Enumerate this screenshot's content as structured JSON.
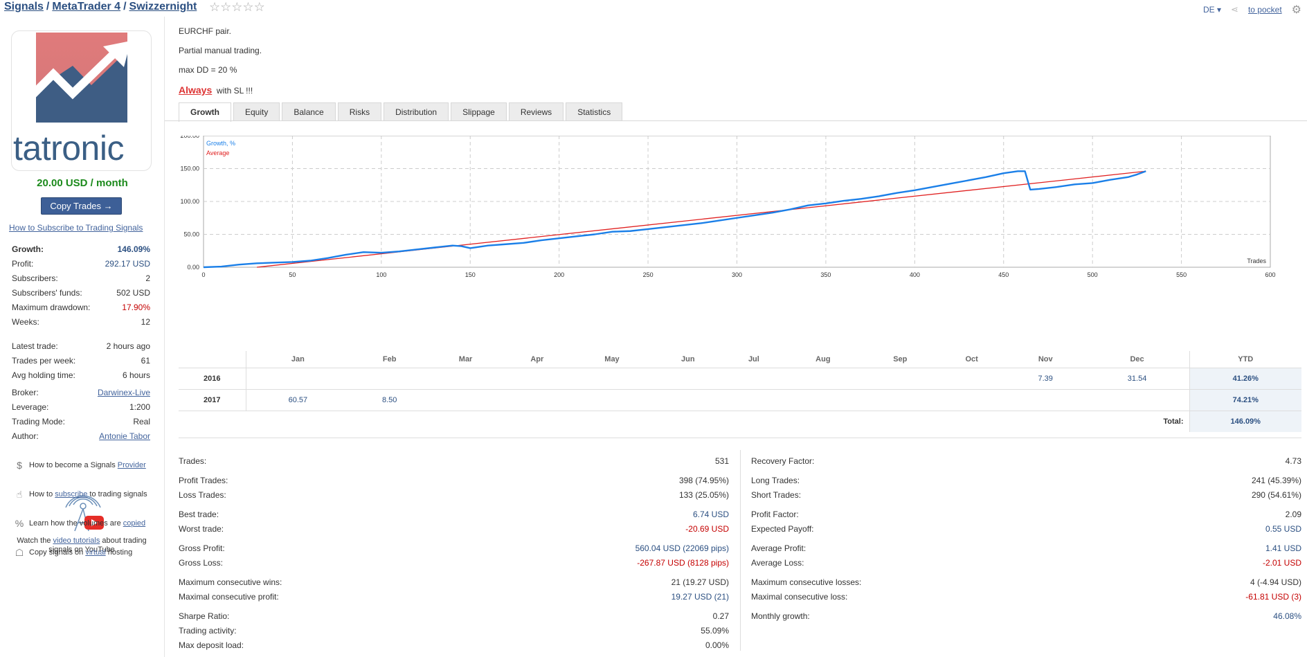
{
  "header": {
    "breadcrumb": [
      "Signals",
      "MetaTrader 4",
      "Swizzernight"
    ],
    "separator": "/",
    "language": "DE",
    "to_pocket": "to pocket"
  },
  "sidebar": {
    "logo_text": "tatronic",
    "price": "20.00 USD / month",
    "copy_button": "Copy Trades →",
    "howto_link": "How to Subscribe to Trading Signals",
    "group1": [
      {
        "k": "Growth:",
        "v": "146.09%"
      },
      {
        "k": "Profit:",
        "v": "292.17 USD"
      },
      {
        "k": "Subscribers:",
        "v": "2"
      },
      {
        "k": "Subscribers' funds:",
        "v": "502 USD"
      },
      {
        "k": "Maximum drawdown:",
        "v": "17.90%"
      },
      {
        "k": "Weeks:",
        "v": "12"
      }
    ],
    "group2": [
      {
        "k": "Latest trade:",
        "v": "2 hours ago"
      },
      {
        "k": "Trades per week:",
        "v": "61"
      },
      {
        "k": "Avg holding time:",
        "v": "6 hours"
      }
    ],
    "group3": [
      {
        "k": "Broker:",
        "v": "Darwinex-Live"
      },
      {
        "k": "Leverage:",
        "v": "1:200"
      },
      {
        "k": "Trading Mode:",
        "v": "Real"
      },
      {
        "k": "Author:",
        "v": "Antonie Tabor"
      }
    ],
    "yt_text_1": "Watch the ",
    "yt_link": "video tutorials",
    "yt_text_2": " about trading signals on YouTube",
    "help": [
      {
        "pre": "How to become a Signals ",
        "link": "Provider",
        "post": ""
      },
      {
        "pre": "How to ",
        "link": "subscribe",
        "post": " to trading signals"
      },
      {
        "pre": "Learn how the volumes are ",
        "link": "copied",
        "post": ""
      },
      {
        "pre": "Copy signals on ",
        "link": "virtual",
        "post": " hosting"
      }
    ]
  },
  "description": {
    "line1": "EURCHF pair.",
    "line2": "Partial manual trading.",
    "line3": "max DD = 20 %",
    "always": "Always",
    "with_sl": "with SL !!!"
  },
  "tabs": [
    "Growth",
    "Equity",
    "Balance",
    "Risks",
    "Distribution",
    "Slippage",
    "Reviews",
    "Statistics"
  ],
  "chart_data": {
    "type": "line",
    "legend": [
      "Growth, %",
      "Average"
    ],
    "xlabel": "Trades",
    "xlim": [
      0,
      600
    ],
    "ylim": [
      0,
      200
    ],
    "x_ticks": [
      0,
      50,
      100,
      150,
      200,
      250,
      300,
      350,
      400,
      450,
      500,
      550,
      600
    ],
    "y_ticks": [
      "0.00",
      "50.00",
      "100.00",
      "150.00",
      "200.00"
    ],
    "colors": {
      "growth": "#1a7fe8",
      "average": "#e02020"
    },
    "series": [
      {
        "name": "Growth, %",
        "x": [
          0,
          10,
          20,
          30,
          40,
          50,
          60,
          70,
          80,
          90,
          100,
          110,
          120,
          130,
          140,
          145,
          150,
          160,
          170,
          180,
          190,
          200,
          210,
          220,
          230,
          240,
          250,
          260,
          270,
          280,
          290,
          300,
          310,
          320,
          330,
          340,
          350,
          360,
          370,
          380,
          390,
          400,
          410,
          420,
          430,
          440,
          450,
          458,
          462,
          465,
          470,
          480,
          490,
          500,
          510,
          520,
          525,
          530
        ],
        "values": [
          0,
          1,
          4,
          6,
          7,
          8,
          10,
          14,
          19,
          23,
          22,
          24,
          27,
          30,
          33,
          32,
          29,
          33,
          35,
          37,
          41,
          44,
          47,
          50,
          54,
          55,
          58,
          61,
          64,
          67,
          71,
          75,
          79,
          83,
          88,
          94,
          97,
          101,
          104,
          108,
          113,
          117,
          122,
          127,
          132,
          137,
          143,
          146,
          146,
          118,
          119,
          122,
          126,
          128,
          133,
          137,
          141,
          146
        ]
      },
      {
        "name": "Average",
        "x": [
          30,
          530
        ],
        "values": [
          0,
          146
        ]
      }
    ]
  },
  "monthly": {
    "months": [
      "Jan",
      "Feb",
      "Mar",
      "Apr",
      "May",
      "Jun",
      "Jul",
      "Aug",
      "Sep",
      "Oct",
      "Nov",
      "Dec"
    ],
    "ytd_label": "YTD",
    "rows": [
      {
        "year": "2016",
        "values": [
          "",
          "",
          "",
          "",
          "",
          "",
          "",
          "",
          "",
          "",
          "7.39",
          "31.54"
        ],
        "ytd": "41.26%"
      },
      {
        "year": "2017",
        "values": [
          "60.57",
          "8.50",
          "",
          "",
          "",
          "",
          "",
          "",
          "",
          "",
          "",
          ""
        ],
        "ytd": "74.21%"
      }
    ],
    "total_label": "Total:",
    "total": "146.09%"
  },
  "stats_left": [
    [
      {
        "k": "Trades:",
        "v": "531"
      }
    ],
    [
      {
        "k": "Profit Trades:",
        "v": "398 (74.95%)"
      },
      {
        "k": "Loss Trades:",
        "v": "133 (25.05%)"
      }
    ],
    [
      {
        "k": "Best trade:",
        "v": "6.74 USD",
        "c": "blue"
      },
      {
        "k": "Worst trade:",
        "v": "-20.69 USD",
        "c": "red"
      }
    ],
    [
      {
        "k": "Gross Profit:",
        "v": "560.04 USD (22069 pips)",
        "c": "blue"
      },
      {
        "k": "Gross Loss:",
        "v": "-267.87 USD (8128 pips)",
        "c": "red"
      }
    ],
    [
      {
        "k": "Maximum consecutive wins:",
        "v": "21 (19.27 USD)"
      },
      {
        "k": "Maximal consecutive profit:",
        "v": "19.27 USD (21)",
        "c": "blue"
      }
    ],
    [
      {
        "k": "Sharpe Ratio:",
        "v": "0.27"
      },
      {
        "k": "Trading activity:",
        "v": "55.09%"
      },
      {
        "k": "Max deposit load:",
        "v": "0.00%"
      }
    ]
  ],
  "stats_right": [
    [
      {
        "k": "Recovery Factor:",
        "v": "4.73"
      }
    ],
    [
      {
        "k": "Long Trades:",
        "v": "241 (45.39%)"
      },
      {
        "k": "Short Trades:",
        "v": "290 (54.61%)"
      }
    ],
    [
      {
        "k": "Profit Factor:",
        "v": "2.09"
      },
      {
        "k": "Expected Payoff:",
        "v": "0.55 USD",
        "c": "blue"
      }
    ],
    [
      {
        "k": "Average Profit:",
        "v": "1.41 USD",
        "c": "blue"
      },
      {
        "k": "Average Loss:",
        "v": "-2.01 USD",
        "c": "red"
      }
    ],
    [
      {
        "k": "Maximum consecutive losses:",
        "v": "4 (-4.94 USD)"
      },
      {
        "k": "Maximal consecutive loss:",
        "v": "-61.81 USD (3)",
        "c": "red"
      }
    ],
    [
      {
        "k": "Monthly growth:",
        "v": "46.08%",
        "c": "blue"
      }
    ]
  ]
}
